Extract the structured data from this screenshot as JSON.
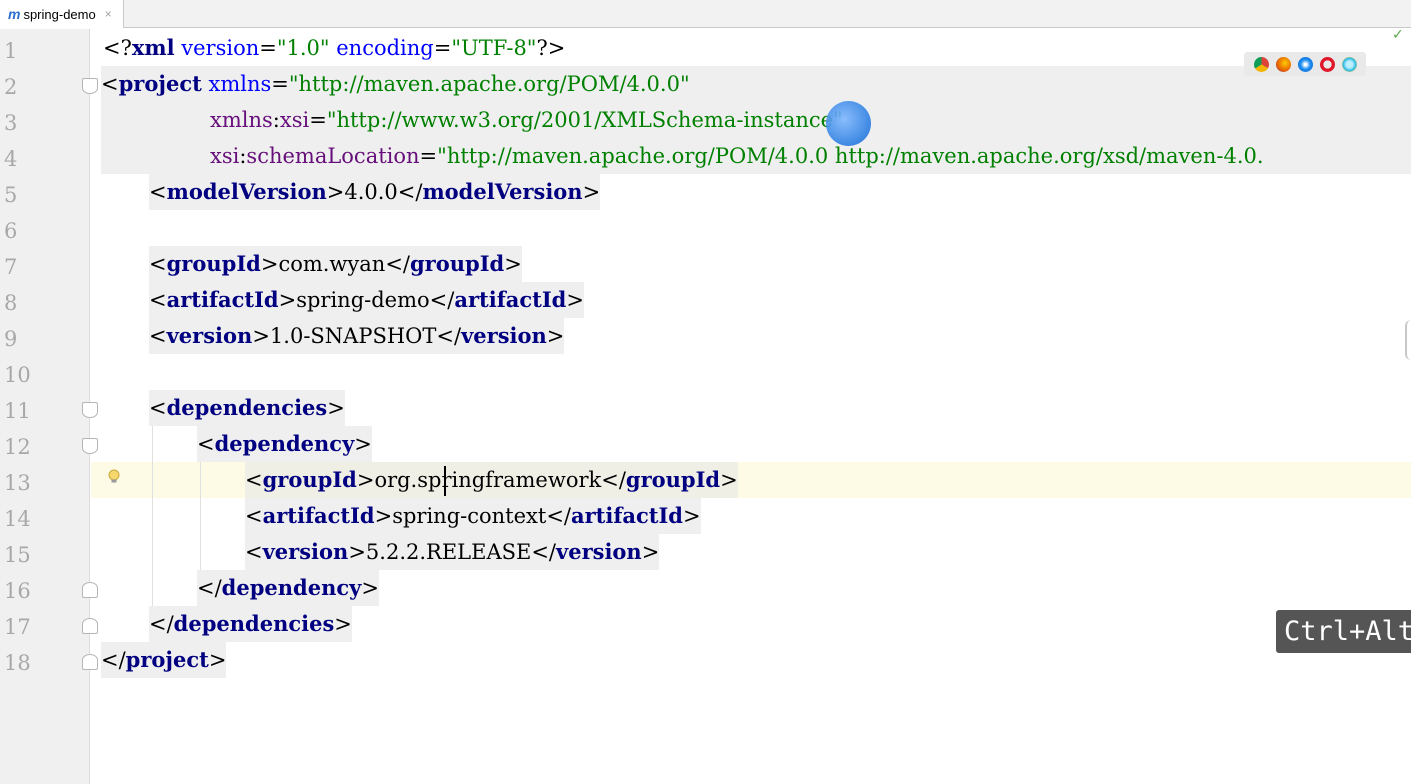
{
  "tab": {
    "icon": "maven-m-icon",
    "icon_text": "m",
    "title": "spring-demo",
    "close": "×"
  },
  "editor": {
    "lines": [
      {
        "n": "1"
      },
      {
        "n": "2"
      },
      {
        "n": "3"
      },
      {
        "n": "4"
      },
      {
        "n": "5"
      },
      {
        "n": "6"
      },
      {
        "n": "7"
      },
      {
        "n": "8"
      },
      {
        "n": "9"
      },
      {
        "n": "10"
      },
      {
        "n": "11"
      },
      {
        "n": "12"
      },
      {
        "n": "13"
      },
      {
        "n": "14"
      },
      {
        "n": "15"
      },
      {
        "n": "16"
      },
      {
        "n": "17"
      },
      {
        "n": "18"
      }
    ],
    "text": {
      "l1_open": "<?",
      "l1_tag": "xml",
      "l1_a1": " version",
      "l1_eq1": "=",
      "l1_v1": "\"1.0\"",
      "l1_a2": " encoding",
      "l1_eq2": "=",
      "l1_v2": "\"UTF-8\"",
      "l1_close": "?>",
      "l2_lt": "<",
      "l2_tag": "project",
      "l2_a": " xmlns",
      "l2_eq": "=",
      "l2_v": "\"http://maven.apache.org/POM/4.0.0\"",
      "l3_ns": "xmlns",
      "l3_colon": ":",
      "l3_a": "xsi",
      "l3_eq": "=",
      "l3_v": "\"http://www.w3.org/2001/XMLSchema-instance\"",
      "l4_ns": "xsi",
      "l4_colon": ":",
      "l4_a": "schemaLocation",
      "l4_eq": "=",
      "l4_v": "\"http://maven.apache.org/POM/4.0.0 http://maven.apache.org/xsd/maven-4.0.",
      "l5_o": "<",
      "l5_t": "modelVersion",
      "l5_c": ">",
      "l5_val": "4.0.0",
      "l5_eo": "</",
      "l5_et": "modelVersion",
      "l5_ec": ">",
      "l7_o": "<",
      "l7_t": "groupId",
      "l7_c": ">",
      "l7_val": "com.wyan",
      "l7_eo": "</",
      "l7_et": "groupId",
      "l7_ec": ">",
      "l8_o": "<",
      "l8_t": "artifactId",
      "l8_c": ">",
      "l8_val": "spring-demo",
      "l8_eo": "</",
      "l8_et": "artifactId",
      "l8_ec": ">",
      "l9_o": "<",
      "l9_t": "version",
      "l9_c": ">",
      "l9_val": "1.0-SNAPSHOT",
      "l9_eo": "</",
      "l9_et": "version",
      "l9_ec": ">",
      "l11_o": "<",
      "l11_t": "dependencies",
      "l11_c": ">",
      "l12_o": "<",
      "l12_t": "dependency",
      "l12_c": ">",
      "l13_o": "<",
      "l13_t": "groupId",
      "l13_c": ">",
      "l13_val": "org.springframework",
      "l13_eo": "</",
      "l13_et": "groupId",
      "l13_ec": ">",
      "l14_o": "<",
      "l14_t": "artifactId",
      "l14_c": ">",
      "l14_val": "spring-context",
      "l14_eo": "</",
      "l14_et": "artifactId",
      "l14_ec": ">",
      "l15_o": "<",
      "l15_t": "version",
      "l15_c": ">",
      "l15_val": "5.2.2.RELEASE",
      "l15_eo": "</",
      "l15_et": "version",
      "l15_ec": ">",
      "l16_o": "</",
      "l16_t": "dependency",
      "l16_c": ">",
      "l17_o": "</",
      "l17_t": "dependencies",
      "l17_c": ">",
      "l18_o": "</",
      "l18_t": "project",
      "l18_c": ">"
    }
  },
  "browser_icons": [
    "chrome-icon",
    "firefox-icon",
    "safari-icon",
    "opera-icon",
    "ie-icon"
  ],
  "tooltip": "Ctrl+Alt",
  "status_check": "✓",
  "colors": {
    "tag": "#000080",
    "attr": "#0000ff",
    "value": "#008000",
    "namespace": "#660e7a",
    "current_line": "#fdfbe6"
  }
}
